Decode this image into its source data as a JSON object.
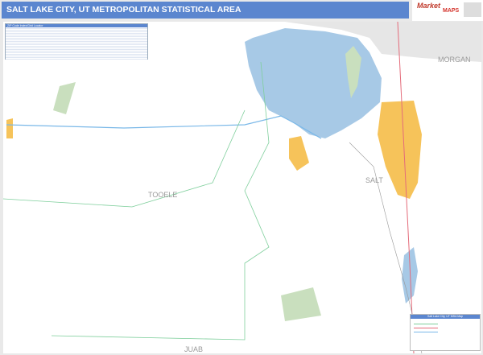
{
  "title": "SALT LAKE CITY, UT METROPOLITAN STATISTICAL AREA",
  "logo": {
    "brand_top": "Market",
    "brand_bottom": "MAPS"
  },
  "zip_index": {
    "header": "ZIP Code Index/Grid Locator"
  },
  "legend": {
    "header": "Salt Lake City, UT MSA Map"
  },
  "counties": [
    "TOOELE",
    "MORGAN",
    "JUAB",
    "SALT"
  ],
  "colors": {
    "title_bar": "#5b86cf",
    "water": "#a7c9e6",
    "urban": "#f6c35a",
    "parks": "#c9dfbe",
    "zip_boundary": "#7fcf9c",
    "interstate": "#7ab8e8",
    "highway": "#e46b7a"
  }
}
